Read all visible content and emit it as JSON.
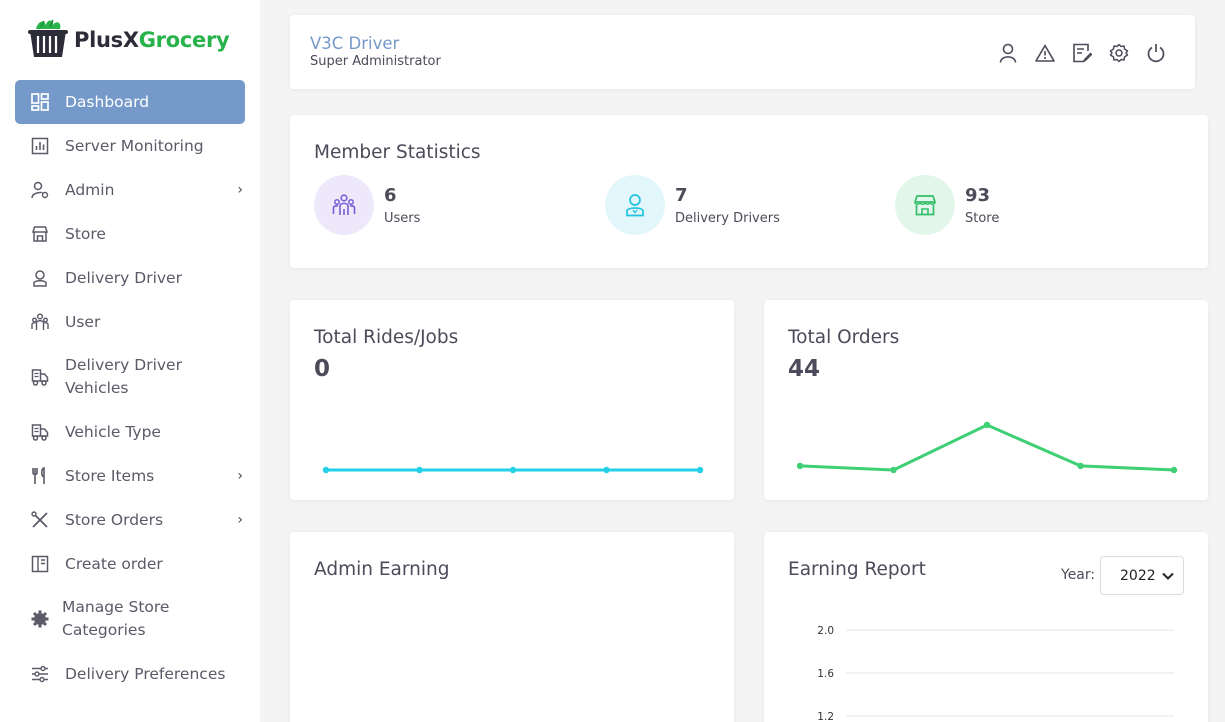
{
  "brand": {
    "part1": "PlusX",
    "part2": "Grocery",
    "color_accent": "#27b24a"
  },
  "sidebar": {
    "items": [
      {
        "label": "Dashboard",
        "icon": "dashboard-icon",
        "active": true
      },
      {
        "label": "Server Monitoring",
        "icon": "chart-icon"
      },
      {
        "label": "Admin",
        "icon": "user-gear-icon",
        "has_submenu": true
      },
      {
        "label": "Store",
        "icon": "store-icon"
      },
      {
        "label": "Delivery Driver",
        "icon": "driver-icon"
      },
      {
        "label": "User",
        "icon": "users-icon"
      },
      {
        "label_lines": [
          "Delivery Driver",
          "Vehicles"
        ],
        "icon": "truck-icon"
      },
      {
        "label": "Vehicle Type",
        "icon": "truck-icon"
      },
      {
        "label": "Store Items",
        "icon": "utensils-icon",
        "has_submenu": true
      },
      {
        "label": "Store Orders",
        "icon": "tools-icon",
        "has_submenu": true
      },
      {
        "label": "Create order",
        "icon": "order-form-icon"
      },
      {
        "label_lines": [
          "Manage Store",
          "Categories"
        ],
        "icon": "gear-solid-icon"
      },
      {
        "label": "Delivery Preferences",
        "icon": "sliders-icon"
      }
    ],
    "submenu_chevron": "›"
  },
  "header": {
    "name": "V3C Driver",
    "role": "Super Administrator",
    "icons": [
      "profile-icon",
      "alert-icon",
      "edit-icon",
      "settings-icon",
      "power-icon"
    ]
  },
  "member_statistics": {
    "title": "Member Statistics",
    "stats": [
      {
        "value": "6",
        "label": "Users",
        "icon": "users-icon",
        "bg": "#ede9fb",
        "fg": "#7a5ed6"
      },
      {
        "value": "7",
        "label": "Delivery Drivers",
        "icon": "driver-icon",
        "bg": "#e2f7fb",
        "fg": "#22c3e0"
      },
      {
        "value": "93",
        "label": "Store",
        "icon": "store-icon",
        "bg": "#e3f6ea",
        "fg": "#34bf6a"
      }
    ]
  },
  "total_rides": {
    "title": "Total Rides/Jobs",
    "value": "0",
    "chart_data": {
      "type": "line",
      "values": [
        0,
        0,
        0,
        0,
        0
      ],
      "color": "#22d1e8"
    }
  },
  "total_orders": {
    "title": "Total Orders",
    "value": "44",
    "chart_data": {
      "type": "line",
      "values": [
        2,
        0,
        22,
        2,
        0
      ],
      "color": "#3fcf74"
    }
  },
  "admin_earning": {
    "title": "Admin Earning"
  },
  "earning_report": {
    "title": "Earning Report",
    "year_label": "Year:",
    "year_value": "2022",
    "chart_data": {
      "type": "line",
      "y_ticks": [
        "2.0",
        "1.6",
        "1.2"
      ],
      "grid": true
    }
  }
}
